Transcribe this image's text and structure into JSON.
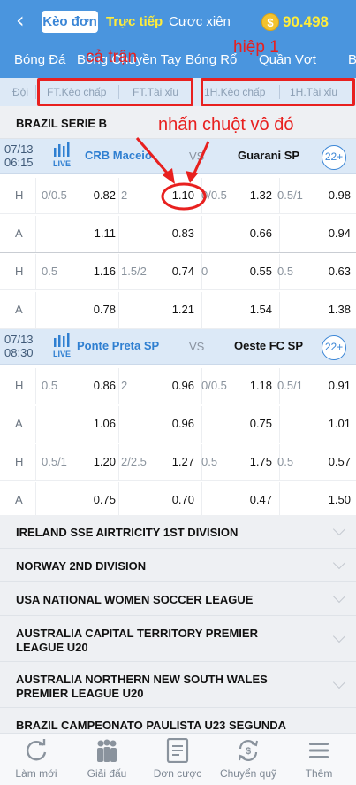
{
  "header": {
    "back_icon": "chevron-left-icon",
    "tab_single": "Kèo đơn",
    "tab_live": "Trực tiếp",
    "tab_parlay": "Cược xiên",
    "coin_symbol": "$",
    "balance": "90.498"
  },
  "sports": [
    "Bóng Đá",
    "Bóng Chuyền Tay",
    "Bóng Rổ",
    "Quần Vợt",
    "B"
  ],
  "columns": {
    "team": "Đội",
    "ft_handicap": "FT.Kèo chấp",
    "ft_overunder": "FT.Tài xỉu",
    "h1_handicap": "1H.Kèo chấp",
    "h1_overunder": "1H.Tài xỉu"
  },
  "annotations": {
    "full_match": "cả trận",
    "first_half": "hiệp 1",
    "click_here": "nhấn chuột vô đó"
  },
  "league": {
    "name": "BRAZIL SERIE B"
  },
  "matches": [
    {
      "date": "07/13",
      "time": "06:15",
      "live": "LIVE",
      "home": "CRB Maceio",
      "vs": "VS",
      "away": "Guarani SP",
      "more": "22+",
      "rows": [
        {
          "side": "H",
          "ft_hdp": "0/0.5",
          "ft_hdp_odd": "0.82",
          "ft_ou": "2",
          "ft_ou_odd": "1.10",
          "h1_hdp": "0/0.5",
          "h1_hdp_odd": "1.32",
          "h1_ou": "0.5/1",
          "h1_ou_odd": "0.98"
        },
        {
          "side": "A",
          "ft_hdp": "",
          "ft_hdp_odd": "1.11",
          "ft_ou": "",
          "ft_ou_odd": "0.83",
          "h1_hdp": "",
          "h1_hdp_odd": "0.66",
          "h1_ou": "",
          "h1_ou_odd": "0.94"
        },
        {
          "side": "H",
          "ft_hdp": "0.5",
          "ft_hdp_odd": "1.16",
          "ft_ou": "1.5/2",
          "ft_ou_odd": "0.74",
          "h1_hdp": "0",
          "h1_hdp_odd": "0.55",
          "h1_ou": "0.5",
          "h1_ou_odd": "0.63"
        },
        {
          "side": "A",
          "ft_hdp": "",
          "ft_hdp_odd": "0.78",
          "ft_ou": "",
          "ft_ou_odd": "1.21",
          "h1_hdp": "",
          "h1_hdp_odd": "1.54",
          "h1_ou": "",
          "h1_ou_odd": "1.38"
        }
      ]
    },
    {
      "date": "07/13",
      "time": "08:30",
      "live": "LIVE",
      "home": "Ponte Preta SP",
      "vs": "VS",
      "away": "Oeste FC SP",
      "more": "22+",
      "rows": [
        {
          "side": "H",
          "ft_hdp": "0.5",
          "ft_hdp_odd": "0.86",
          "ft_ou": "2",
          "ft_ou_odd": "0.96",
          "h1_hdp": "0/0.5",
          "h1_hdp_odd": "1.18",
          "h1_ou": "0.5/1",
          "h1_ou_odd": "0.91"
        },
        {
          "side": "A",
          "ft_hdp": "",
          "ft_hdp_odd": "1.06",
          "ft_ou": "",
          "ft_ou_odd": "0.96",
          "h1_hdp": "",
          "h1_hdp_odd": "0.75",
          "h1_ou": "",
          "h1_ou_odd": "1.01"
        },
        {
          "side": "H",
          "ft_hdp": "0.5/1",
          "ft_hdp_odd": "1.20",
          "ft_ou": "2/2.5",
          "ft_ou_odd": "1.27",
          "h1_hdp": "0.5",
          "h1_hdp_odd": "1.75",
          "h1_ou": "0.5",
          "h1_ou_odd": "0.57"
        },
        {
          "side": "A",
          "ft_hdp": "",
          "ft_hdp_odd": "0.75",
          "ft_ou": "",
          "ft_ou_odd": "0.70",
          "h1_hdp": "",
          "h1_hdp_odd": "0.47",
          "h1_ou": "",
          "h1_ou_odd": "1.50"
        }
      ]
    }
  ],
  "collapsed_leagues": [
    "IRELAND SSE AIRTRICITY 1ST DIVISION",
    "NORWAY 2ND DIVISION",
    "USA NATIONAL WOMEN SOCCER LEAGUE",
    "AUSTRALIA CAPITAL TERRITORY PREMIER LEAGUE U20",
    "AUSTRALIA NORTHERN NEW SOUTH WALES PREMIER LEAGUE U20",
    "BRAZIL CAMPEONATO PAULISTA U23 SEGUNDA"
  ],
  "nav": [
    {
      "label": "Làm mới",
      "icon": "refresh-icon"
    },
    {
      "label": "Giải đấu",
      "icon": "leagues-icon"
    },
    {
      "label": "Đơn cược",
      "icon": "bet-slip-icon"
    },
    {
      "label": "Chuyển quỹ",
      "icon": "transfer-icon"
    },
    {
      "label": "Thêm",
      "icon": "menu-icon"
    }
  ],
  "colors": {
    "primary": "#4a95de",
    "header_strip": "#dde9f6",
    "highlight": "#ffec3a",
    "annotation": "#e8201f",
    "link_blue": "#2f7fd1"
  }
}
